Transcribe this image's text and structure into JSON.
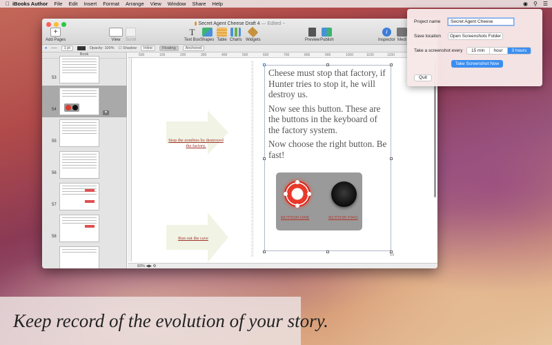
{
  "menubar": {
    "app_name": "iBooks Author",
    "items": [
      "File",
      "Edit",
      "Insert",
      "Format",
      "Arrange",
      "View",
      "Window",
      "Share",
      "Help"
    ],
    "right_icons": [
      "app-status-icon",
      "search-icon",
      "list-icon"
    ]
  },
  "window": {
    "doc_name": "Secret Agent Cheese Draft 4",
    "doc_status": "— Edited ~",
    "toolbar": {
      "add_pages": "Add Pages",
      "view": "View",
      "scroll": "Scroll",
      "text_box": "Text Box",
      "shapes": "Shapes",
      "table": "Table",
      "charts": "Charts",
      "widgets": "Widgets",
      "preview": "Preview",
      "publish": "Publish",
      "inspector": "Inspector",
      "media": "Medi"
    },
    "formatbar": {
      "stroke": "1 pt",
      "opacity": "Opacity: 100%",
      "shadow": "Shadow",
      "wrap_inline": "Inline",
      "wrap_floating": "Floating",
      "wrap_anchored": "Anchored"
    },
    "sidebar": {
      "header": "Book",
      "pages": [
        "53",
        "54",
        "55",
        "56",
        "57",
        "58"
      ]
    },
    "rulers": {
      "ticks": [
        "600",
        "100",
        "200",
        "300",
        "400",
        "500",
        "600",
        "700",
        "800",
        "900",
        "1000",
        "1100",
        "1200",
        "1300"
      ]
    },
    "canvas": {
      "arrow1_label": "Stop the zombies by destroyed the factory.",
      "arrow2_label": "Run out the cave",
      "paragraphs": [
        "Cheese must stop that factory, if Hunter tries to stop it, he will destroy us.",
        "Now see this button. These are the buttons in the keyboard of the factory system.",
        "Now choose the right button. Be fast!"
      ],
      "button_one_label": "BUTTON ONE",
      "button_two_label": "BUTTON TWO",
      "page_number": "54"
    },
    "status": {
      "zoom": "83%"
    }
  },
  "popover": {
    "project_name_label": "Project name",
    "project_name_value": "Secret Agent Cheese",
    "save_location_label": "Save location",
    "open_folder_button": "Open Screenshots Folder",
    "interval_label": "Take a screenshot every",
    "interval_options": [
      "15 min",
      "hour",
      "3 hours"
    ],
    "interval_selected": "3 hours",
    "take_now_button": "Take Screenshot Now",
    "quit_button": "Quit",
    "accent_color": "#3b8ef0"
  },
  "caption": {
    "text": "Keep record of the evolution of your story."
  }
}
